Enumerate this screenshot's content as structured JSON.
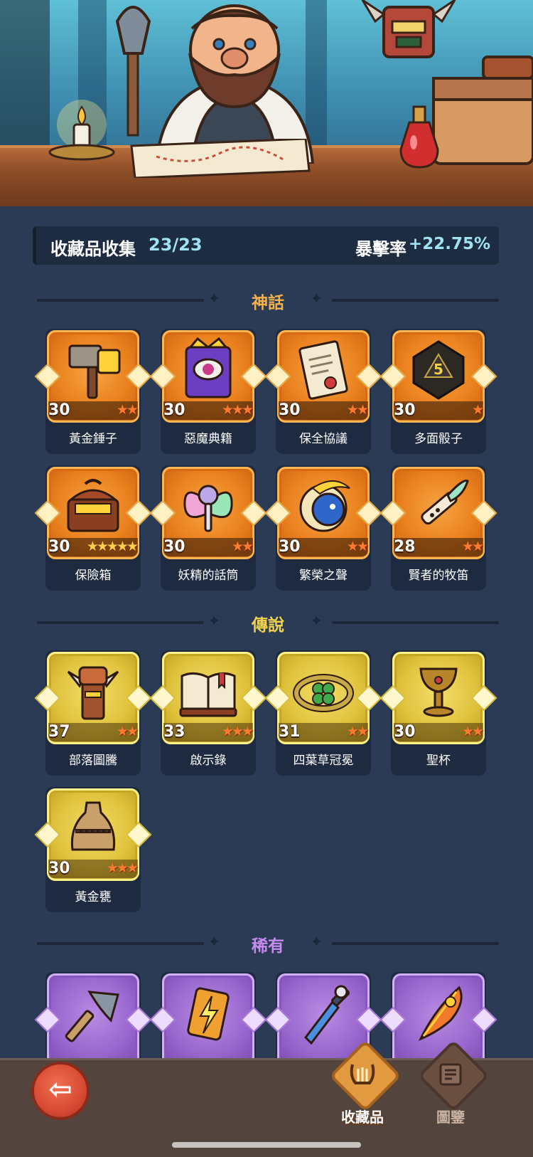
{
  "stats": {
    "collection_label": "收藏品收集",
    "collection_count": "23/23",
    "crit_label": "暴擊率",
    "crit_value": "+22.75%"
  },
  "sections": {
    "mythic": {
      "title": "神話",
      "color": "#f4b24b"
    },
    "legendary": {
      "title": "傳說",
      "color": "#f4d24b"
    },
    "rare": {
      "title": "稀有",
      "color": "#c58cf0"
    }
  },
  "mythic_items": [
    {
      "name": "黃金錘子",
      "level": "30",
      "stars": "★★",
      "icon": "golden-hammer-icon"
    },
    {
      "name": "惡魔典籍",
      "level": "30",
      "stars": "★★★",
      "icon": "demon-tome-icon"
    },
    {
      "name": "保全協議",
      "level": "30",
      "stars": "★★",
      "icon": "contract-scroll-icon"
    },
    {
      "name": "多面骰子",
      "level": "30",
      "stars": "★",
      "icon": "polyhedral-dice-icon"
    },
    {
      "name": "保險箱",
      "level": "30",
      "stars": "★★★★★",
      "icon": "treasure-chest-icon"
    },
    {
      "name": "妖精的話筒",
      "level": "30",
      "stars": "★★",
      "icon": "fairy-microphone-icon"
    },
    {
      "name": "繁榮之聲",
      "level": "30",
      "stars": "★★",
      "icon": "prosperity-shell-icon"
    },
    {
      "name": "賢者的牧笛",
      "level": "28",
      "stars": "★★",
      "icon": "sage-flute-icon"
    }
  ],
  "legendary_items": [
    {
      "name": "部落圖騰",
      "level": "37",
      "stars": "★★",
      "icon": "tribal-totem-icon"
    },
    {
      "name": "啟示錄",
      "level": "33",
      "stars": "★★★",
      "icon": "open-book-icon"
    },
    {
      "name": "四葉草冠冕",
      "level": "31",
      "stars": "★★",
      "icon": "clover-crown-icon"
    },
    {
      "name": "聖杯",
      "level": "30",
      "stars": "★★",
      "icon": "holy-grail-icon"
    },
    {
      "name": "黃金甕",
      "level": "30",
      "stars": "★★★",
      "icon": "golden-urn-icon"
    }
  ],
  "rare_items": [
    {
      "icon": "battle-axe-icon"
    },
    {
      "icon": "lightning-card-icon"
    },
    {
      "icon": "ice-dagger-icon"
    },
    {
      "icon": "phoenix-feather-icon"
    }
  ],
  "nav": {
    "collection_label": "收藏品",
    "codex_label": "圖鑒"
  }
}
